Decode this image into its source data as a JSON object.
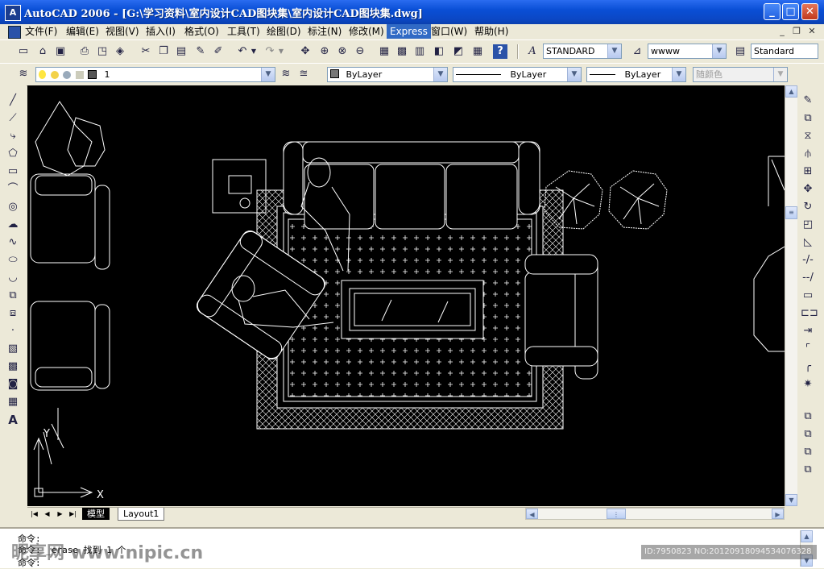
{
  "window": {
    "title": "AutoCAD 2006 - [G:\\学习资料\\室内设计CAD图块集\\室内设计CAD图块集.dwg]",
    "app_icon": "A",
    "minimize": "_",
    "maximize": "□",
    "close": "✕"
  },
  "menu": [
    {
      "label": "文件(F)"
    },
    {
      "label": "编辑(E)"
    },
    {
      "label": "视图(V)"
    },
    {
      "label": "插入(I)"
    },
    {
      "label": "格式(O)"
    },
    {
      "label": "工具(T)"
    },
    {
      "label": "绘图(D)"
    },
    {
      "label": "标注(N)"
    },
    {
      "label": "修改(M)"
    },
    {
      "label": "Express"
    },
    {
      "label": "窗口(W)"
    },
    {
      "label": "帮助(H)"
    }
  ],
  "mdi": {
    "minimize": "_",
    "restore": "❐",
    "close": "✕"
  },
  "styles_toolbar": {
    "text_style": "STANDARD",
    "dim_style": "wwww",
    "table_style": "Standard"
  },
  "layers_toolbar": {
    "layer_name": "1",
    "color": "ByLayer",
    "linetype": "ByLayer",
    "lineweight": "ByLayer",
    "plotstyle": "随颜色"
  },
  "tabs": {
    "model": "模型",
    "layout1": "Layout1"
  },
  "ucs": {
    "x": "X",
    "y": "Y"
  },
  "command": {
    "line1": "命令:",
    "line2": "命令: _erase 找到 1 个",
    "line3": "命令:"
  },
  "watermark": {
    "left": "昵享网 www.nipic.cn",
    "right": "ID:7950823 NO:20120918094534076328"
  },
  "colors": {
    "titlebar": "#0a4fd6",
    "canvas": "#000000",
    "linework": "#ffffff",
    "menu_active": "#316ac5"
  }
}
